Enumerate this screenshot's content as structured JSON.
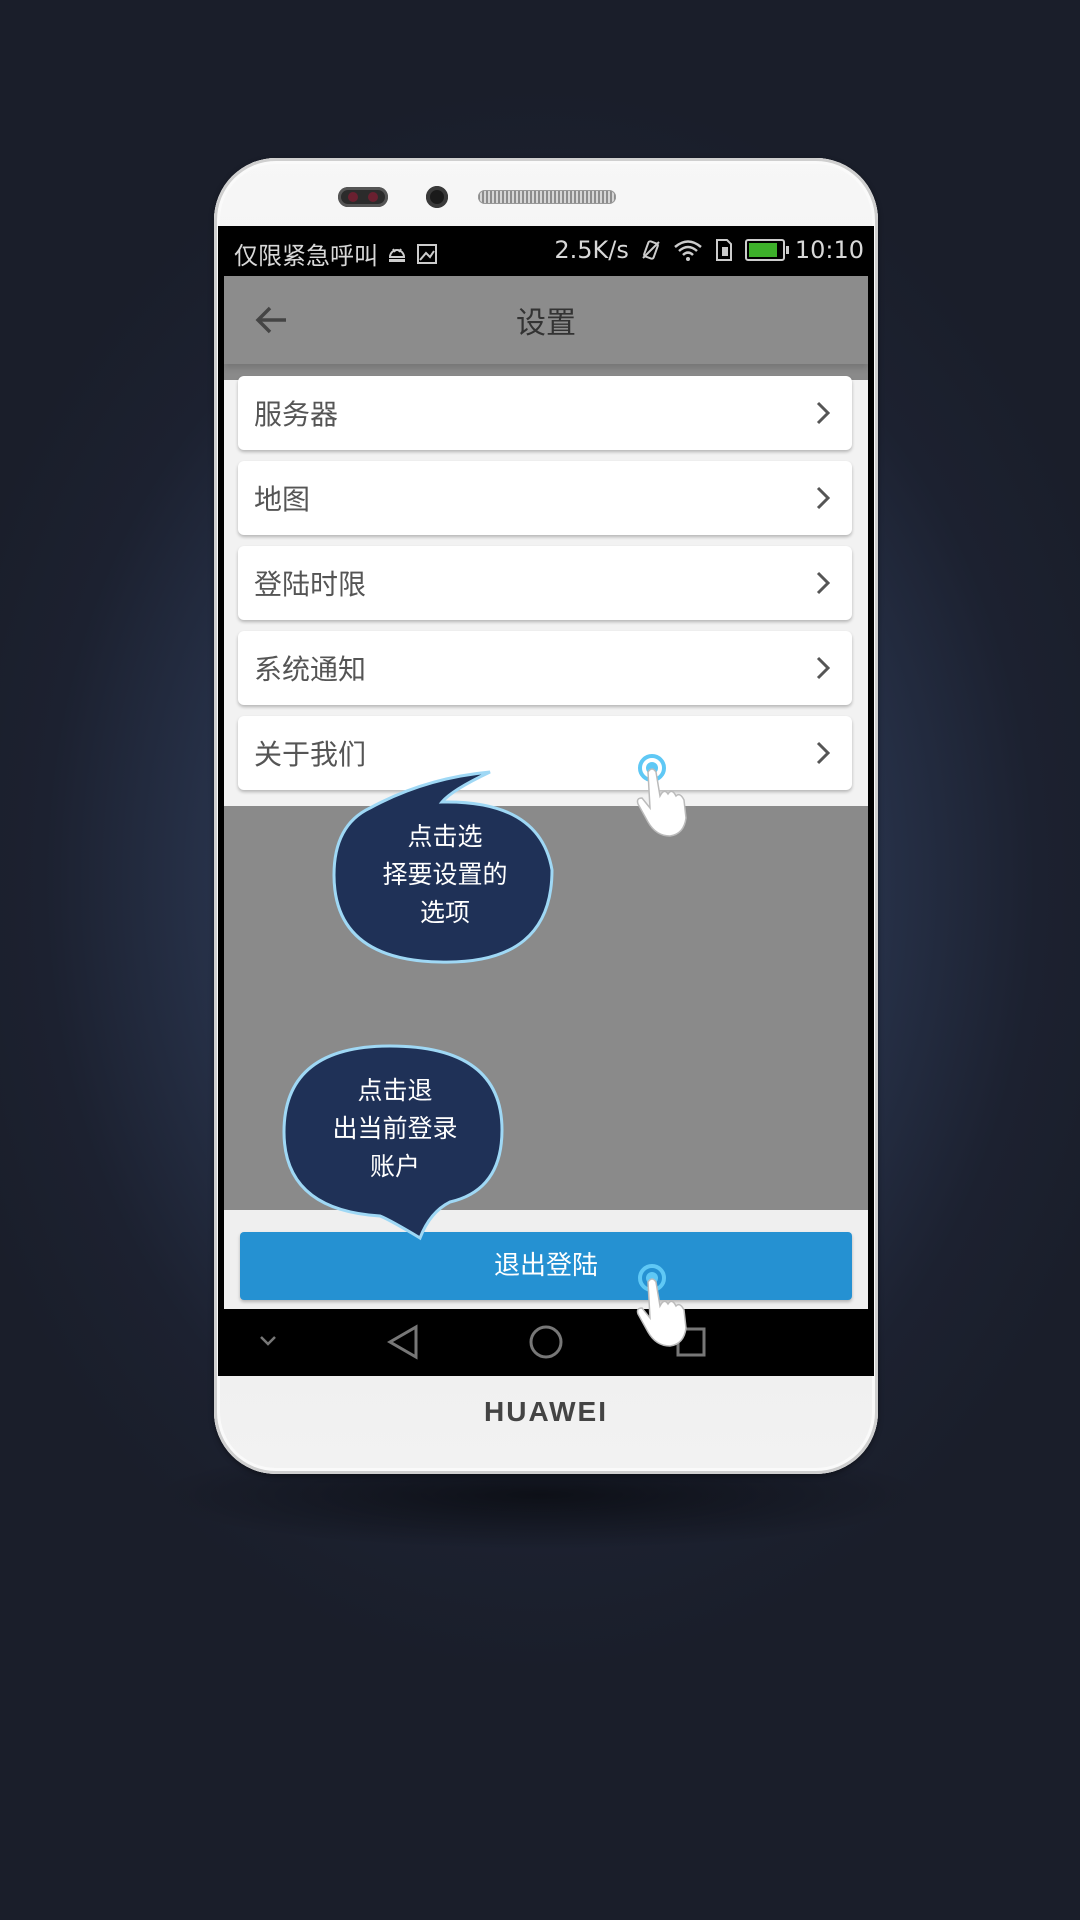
{
  "device": {
    "brand": "HUAWEI"
  },
  "status_bar": {
    "carrier": "仅限紧急呼叫",
    "speed": "2.5K/s",
    "time": "10:10"
  },
  "app_bar": {
    "title": "设置",
    "back_icon": "arrow-left-icon"
  },
  "settings_items": [
    {
      "label": "服务器"
    },
    {
      "label": "地图"
    },
    {
      "label": "登陆时限"
    },
    {
      "label": "系统通知"
    },
    {
      "label": "关于我们"
    }
  ],
  "logout_button": {
    "label": "退出登陆"
  },
  "annotations": {
    "tip_select": [
      "点击选",
      "择要设置的",
      "选项"
    ],
    "tip_logout": [
      "点击退",
      "出当前登录",
      "账户"
    ]
  },
  "colors": {
    "accent": "#2591d2",
    "bubble_fill": "#1f3157",
    "bubble_stroke": "#9fd8f5"
  }
}
